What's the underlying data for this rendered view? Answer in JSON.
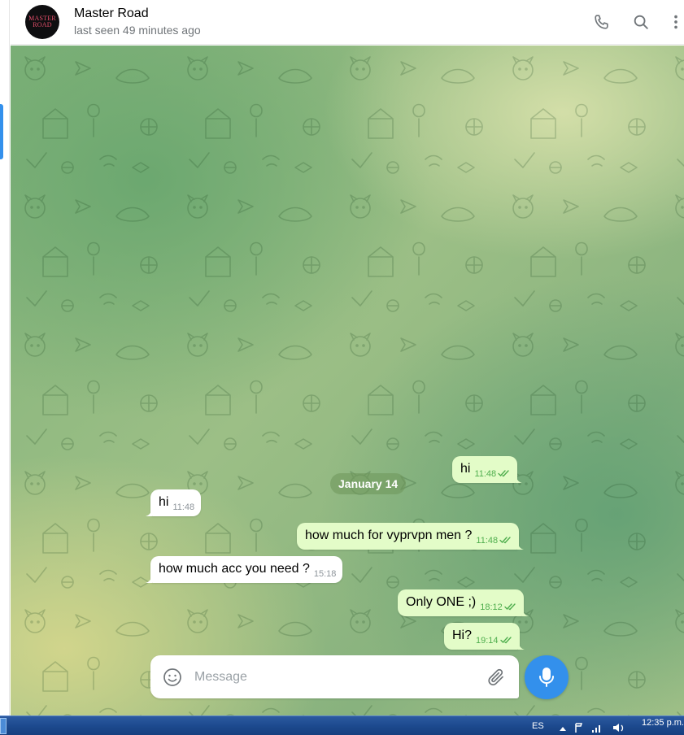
{
  "chat": {
    "title": "Master Road",
    "status": "last seen 49 minutes ago",
    "avatar_text": "MASTER ROAD"
  },
  "date_separator": "January 14",
  "messages": [
    {
      "direction": "out",
      "text": "hi",
      "time": "11:48",
      "read": true
    },
    {
      "direction": "in",
      "text": "hi",
      "time": "11:48"
    },
    {
      "direction": "out",
      "text": "how much for vyprvpn men ?",
      "time": "11:48",
      "read": true
    },
    {
      "direction": "in",
      "text": "how much acc you need ?",
      "time": "15:18"
    },
    {
      "direction": "out",
      "text": "Only ONE ;)",
      "time": "18:12",
      "read": true
    },
    {
      "direction": "out",
      "text": "Hi?",
      "time": "19:14",
      "read": true
    }
  ],
  "composer": {
    "placeholder": "Message"
  },
  "icons": {
    "call": "phone-icon",
    "search": "search-icon",
    "more": "more-vertical-icon",
    "emoji": "smiley-icon",
    "attach": "paperclip-icon",
    "mic": "microphone-icon"
  },
  "taskbar": {
    "language": "ES",
    "clock": "12:35 p.m."
  },
  "colors": {
    "accent": "#3390ec",
    "outgoing_bubble": "#e3fcc8",
    "incoming_bubble": "#ffffff",
    "read_check": "#4fae4e"
  }
}
